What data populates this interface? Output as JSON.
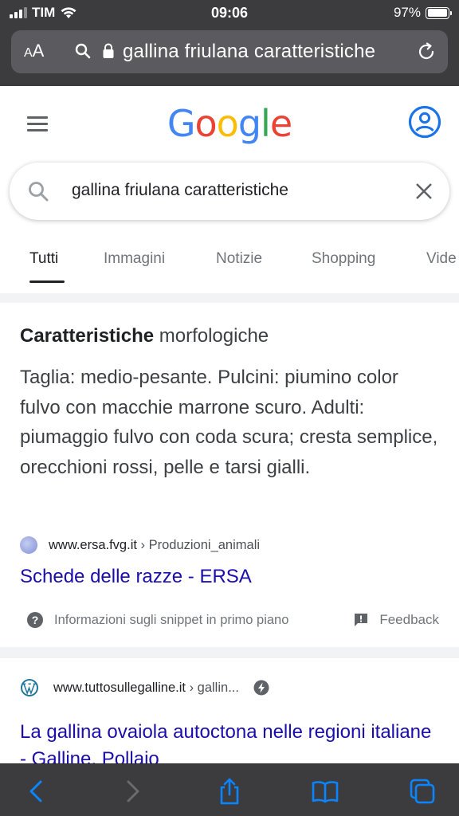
{
  "status_bar": {
    "carrier": "TIM",
    "time": "09:06",
    "battery_percent": "97%",
    "battery_level": 0.97,
    "signal_bars": 3,
    "icons": [
      "signal-icon",
      "wifi-icon",
      "battery-icon"
    ]
  },
  "safari": {
    "text_size_label": "AA",
    "url_text": "gallina friulana caratteristiche",
    "icons": [
      "search-icon",
      "lock-icon",
      "reload-icon"
    ],
    "toolbar_icons": [
      "back-icon",
      "forward-icon",
      "share-icon",
      "bookmarks-icon",
      "tabs-icon"
    ]
  },
  "google": {
    "logo": [
      "G",
      "o",
      "o",
      "g",
      "l",
      "e"
    ],
    "search_query": "gallina friulana caratteristiche",
    "tabs": [
      {
        "label": "Tutti",
        "active": true
      },
      {
        "label": "Immagini",
        "active": false
      },
      {
        "label": "Notizie",
        "active": false
      },
      {
        "label": "Shopping",
        "active": false
      },
      {
        "label": "Vide",
        "active": false
      }
    ]
  },
  "featured_snippet": {
    "title_bold": "Caratteristiche",
    "title_rest": " morfologiche",
    "body": "Taglia: medio-pesante. Pulcini: piumino color fulvo con macchie marrone scuro. Adulti: piumaggio fulvo con coda scura; cresta semplice, orecchioni rossi, pelle e tarsi gialli.",
    "source_domain": "www.ersa.fvg.it",
    "source_crumb": " › Produzioni_animali",
    "link_title": "Schede delle razze - ERSA",
    "help_text": "Informazioni sugli snippet in primo piano",
    "feedback_label": "Feedback"
  },
  "result2": {
    "source_domain": "www.tuttosullegalline.it",
    "source_crumb": " › gallin...",
    "link_title": "La gallina ovaiola autoctona nelle regioni italiane - Galline, Pollaio"
  },
  "colors": {
    "link": "#1a0dab",
    "google_blue": "#4285f4",
    "google_red": "#ea4335",
    "google_yellow": "#fbbc05",
    "google_green": "#34a853",
    "safari_bar": "#3c3c3e",
    "safari_accent": "#0a84ff"
  }
}
